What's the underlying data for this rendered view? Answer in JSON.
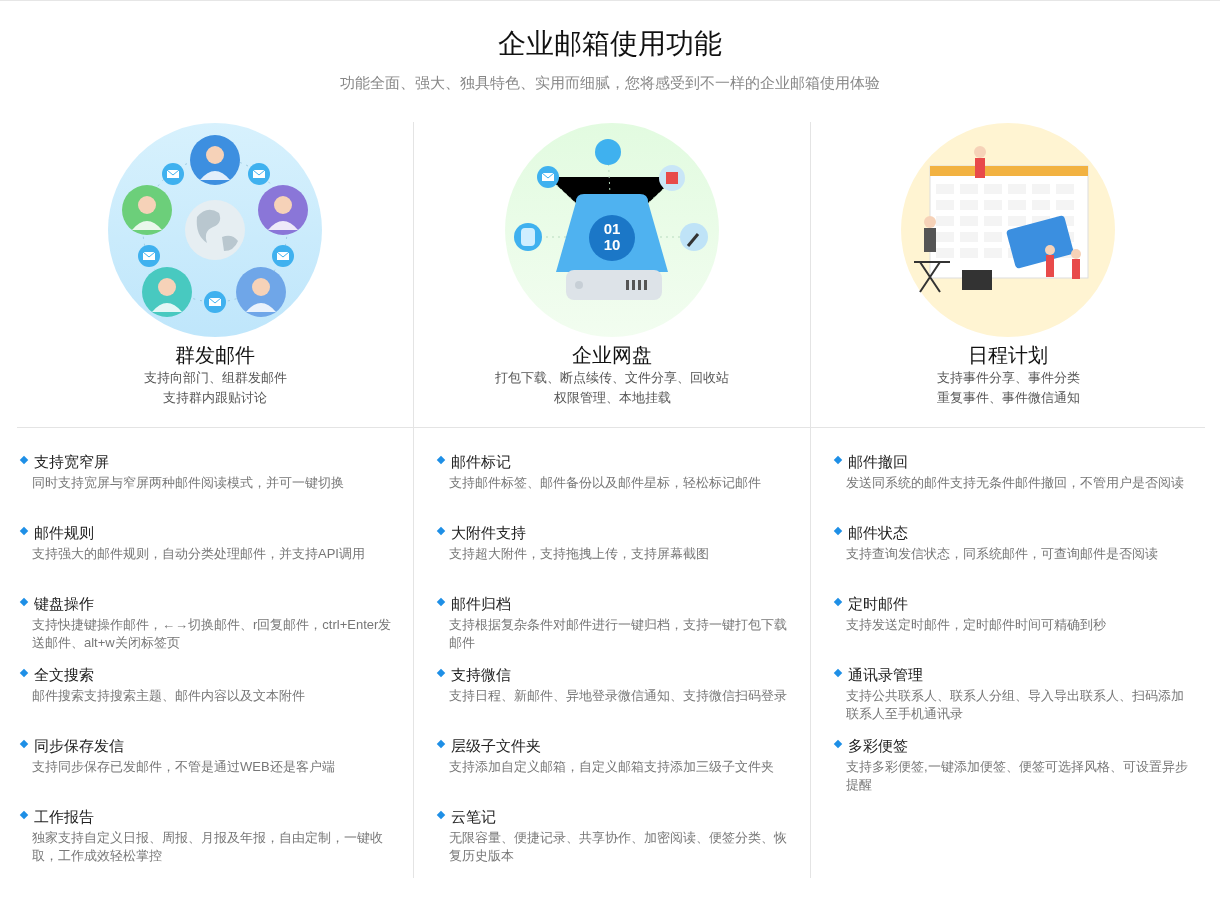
{
  "title": "企业邮箱使用功能",
  "subtitle": "功能全面、强大、独具特色、实用而细腻，您将感受到不一样的企业邮箱使用体验",
  "columns": [
    {
      "illustration": {
        "kind": "group-mail"
      },
      "heading": "群发邮件",
      "lines": [
        "支持向部门、组群发邮件",
        "支持群内跟贴讨论"
      ],
      "features": [
        {
          "title": "支持宽窄屏",
          "desc": "同时支持宽屏与窄屏两种邮件阅读模式，并可一键切换"
        },
        {
          "title": "邮件规则",
          "desc": "支持强大的邮件规则，自动分类处理邮件，并支持API调用"
        },
        {
          "title": "键盘操作",
          "desc": "支持快捷键操作邮件，←→切换邮件、r回复邮件，ctrl+Enter发送邮件、alt+w关闭标签页"
        },
        {
          "title": "全文搜索",
          "desc": "邮件搜索支持搜索主题、邮件内容以及文本附件"
        },
        {
          "title": "同步保存发信",
          "desc": "支持同步保存已发邮件，不管是通过WEB还是客户端"
        },
        {
          "title": "工作报告",
          "desc": "独家支持自定义日报、周报、月报及年报，自由定制，一键收取，工作成效轻松掌控"
        }
      ]
    },
    {
      "illustration": {
        "kind": "drive",
        "label": [
          "01",
          "10"
        ]
      },
      "heading": "企业网盘",
      "lines": [
        "打包下载、断点续传、文件分享、回收站",
        "权限管理、本地挂载"
      ],
      "features": [
        {
          "title": "邮件标记",
          "desc": "支持邮件标签、邮件备份以及邮件星标，轻松标记邮件"
        },
        {
          "title": "大附件支持",
          "desc": "支持超大附件，支持拖拽上传，支持屏幕截图"
        },
        {
          "title": "邮件归档",
          "desc": "支持根据复杂条件对邮件进行一键归档，支持一键打包下载邮件"
        },
        {
          "title": "支持微信",
          "desc": "支持日程、新邮件、异地登录微信通知、支持微信扫码登录"
        },
        {
          "title": "层级子文件夹",
          "desc": "支持添加自定义邮箱，自定义邮箱支持添加三级子文件夹"
        },
        {
          "title": "云笔记",
          "desc": "无限容量、便捷记录、共享协作、加密阅读、便签分类、恢复历史版本"
        }
      ]
    },
    {
      "illustration": {
        "kind": "calendar"
      },
      "heading": "日程计划",
      "lines": [
        "支持事件分享、事件分类",
        "重复事件、事件微信通知"
      ],
      "features": [
        {
          "title": "邮件撤回",
          "desc": "发送同系统的邮件支持无条件邮件撤回，不管用户是否阅读"
        },
        {
          "title": "邮件状态",
          "desc": "支持查询发信状态，同系统邮件，可查询邮件是否阅读"
        },
        {
          "title": "定时邮件",
          "desc": "支持发送定时邮件，定时邮件时间可精确到秒"
        },
        {
          "title": "通讯录管理",
          "desc": "支持公共联系人、联系人分组、导入导出联系人、扫码添加联系人至手机通讯录"
        },
        {
          "title": "多彩便签",
          "desc": "支持多彩便签,一键添加便签、便签可选择风格、可设置异步提醒"
        }
      ]
    }
  ]
}
